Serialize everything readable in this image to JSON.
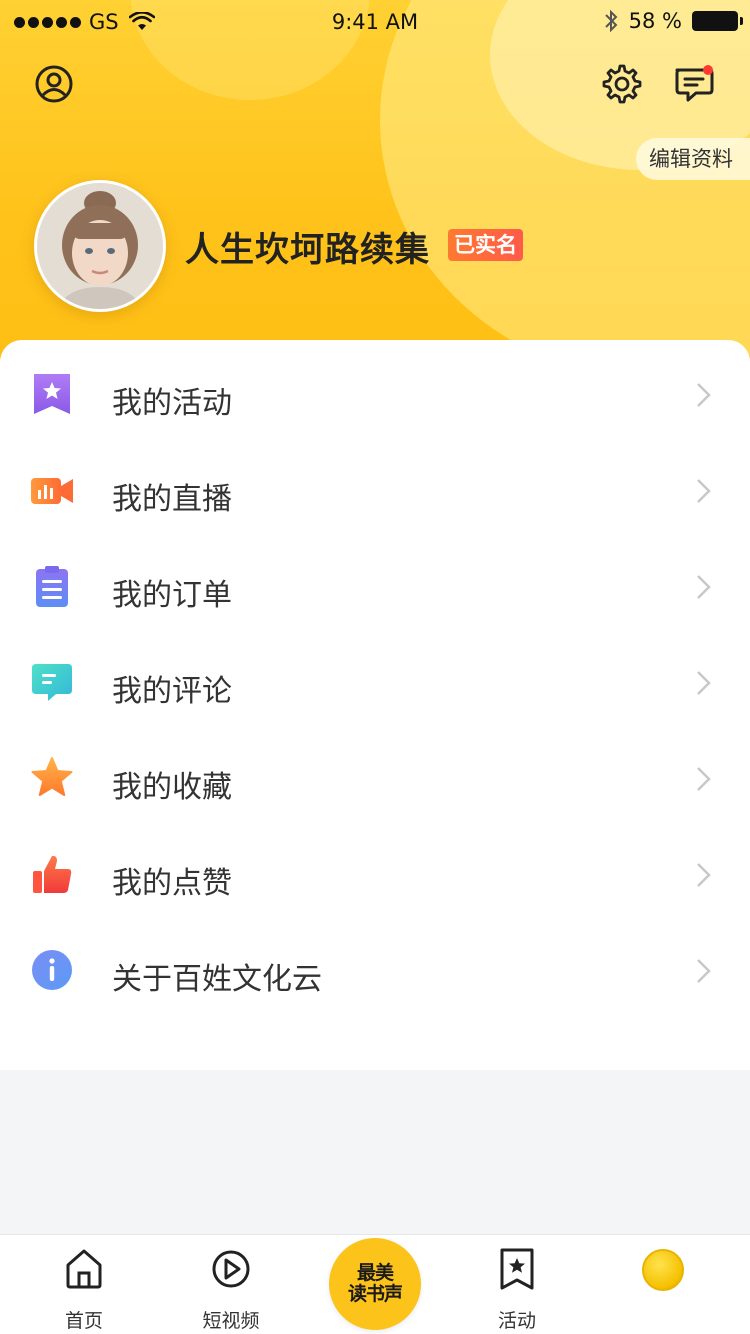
{
  "status_bar": {
    "carrier": "GS",
    "time": "9:41 AM",
    "battery": "58 %"
  },
  "header": {
    "edit_profile_label": "编辑资料",
    "username": "人生坎坷路续集",
    "verified_label": "已实名"
  },
  "menu": {
    "items": [
      {
        "label": "我的活动",
        "icon": "bookmark-star-icon",
        "color": "#9b6cf0"
      },
      {
        "label": "我的直播",
        "icon": "video-camera-icon",
        "color": "#ff7a3d"
      },
      {
        "label": "我的订单",
        "icon": "clipboard-icon",
        "color": "#6a7cf5"
      },
      {
        "label": "我的评论",
        "icon": "comment-icon",
        "color": "#3ccfc0"
      },
      {
        "label": "我的收藏",
        "icon": "star-icon",
        "color": "#ff9a2e"
      },
      {
        "label": "我的点赞",
        "icon": "thumbs-up-icon",
        "color": "#ff5540"
      },
      {
        "label": "关于百姓文化云",
        "icon": "info-icon",
        "color": "#6f8cf5"
      }
    ]
  },
  "tabbar": {
    "home_label": "首页",
    "video_label": "短视频",
    "center_line1": "最美",
    "center_line2": "读书声",
    "activity_label": "活动"
  },
  "colors": {
    "brand_yellow": "#ffc21a",
    "badge_red": "#ff5a4a",
    "notification_dot": "#ff3b30"
  }
}
